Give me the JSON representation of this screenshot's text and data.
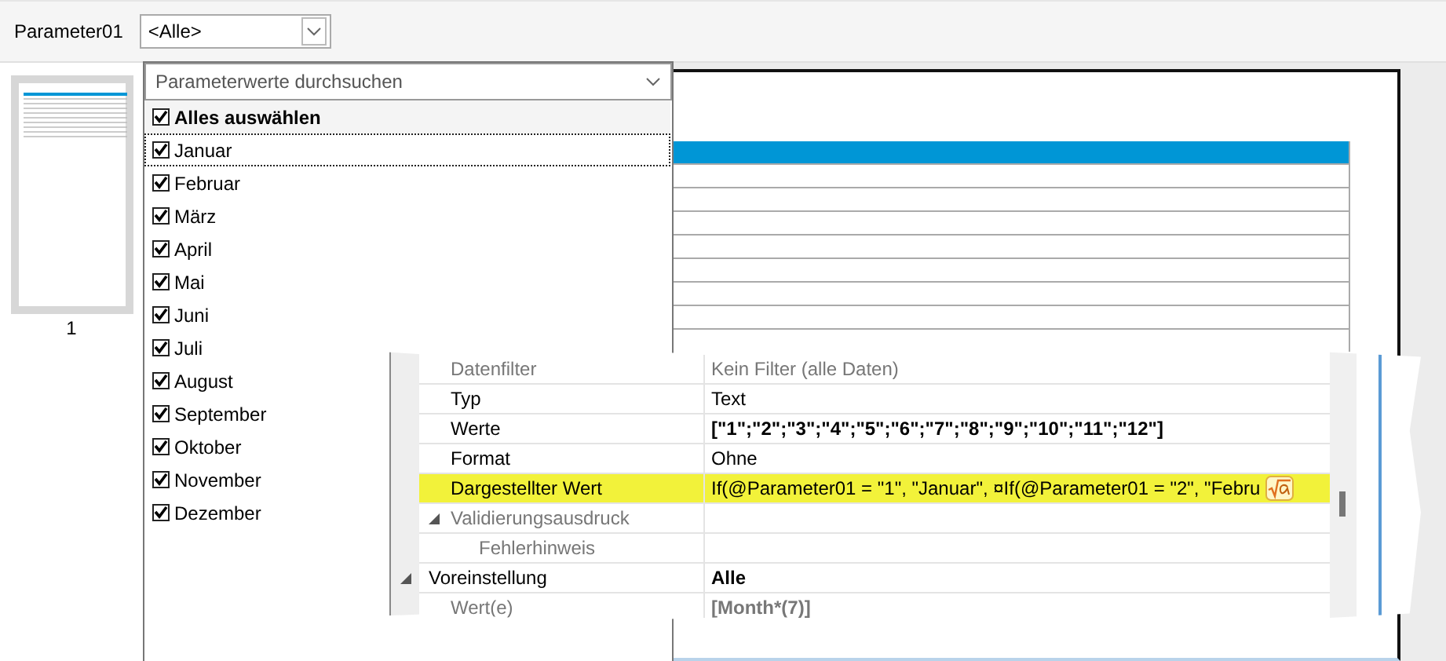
{
  "parameter": {
    "label": "Parameter01",
    "value": "<Alle>"
  },
  "thumbnails": [
    {
      "page": "1",
      "selected": true
    }
  ],
  "dropdown": {
    "placeholder": "Parameterwerte durchsuchen",
    "select_all": {
      "label": "Alles auswählen",
      "checked": true
    },
    "items": [
      {
        "label": "Januar",
        "checked": true,
        "focused": true
      },
      {
        "label": "Februar",
        "checked": true,
        "focused": false
      },
      {
        "label": "März",
        "checked": true,
        "focused": false
      },
      {
        "label": "April",
        "checked": true,
        "focused": false
      },
      {
        "label": "Mai",
        "checked": true,
        "focused": false
      },
      {
        "label": "Juni",
        "checked": true,
        "focused": false
      },
      {
        "label": "Juli",
        "checked": true,
        "focused": false
      },
      {
        "label": "August",
        "checked": true,
        "focused": false
      },
      {
        "label": "September",
        "checked": true,
        "focused": false
      },
      {
        "label": "Oktober",
        "checked": true,
        "focused": false
      },
      {
        "label": "November",
        "checked": true,
        "focused": false
      },
      {
        "label": "Dezember",
        "checked": true,
        "focused": false
      }
    ]
  },
  "properties": [
    {
      "kind": "property",
      "name": "Datenfilter",
      "value": "Kein Filter (alle Daten)",
      "disabled": true,
      "highlighted": false,
      "bold_value": false
    },
    {
      "kind": "property",
      "name": "Typ",
      "value": "Text",
      "disabled": false,
      "highlighted": false,
      "bold_value": false
    },
    {
      "kind": "property",
      "name": "Werte",
      "value": "[\"1\";\"2\";\"3\";\"4\";\"5\";\"6\";\"7\";\"8\";\"9\";\"10\";\"11\";\"12\"]",
      "disabled": false,
      "highlighted": false,
      "bold_value": true
    },
    {
      "kind": "property",
      "name": "Format",
      "value": "Ohne",
      "disabled": false,
      "highlighted": false,
      "bold_value": false
    },
    {
      "kind": "expression",
      "name": "Dargestellter Wert",
      "value": "If(@Parameter01 = \"1\", \"Januar\", ¤If(@Parameter01 = \"2\", \"Febru",
      "disabled": false,
      "highlighted": true,
      "bold_value": false
    },
    {
      "kind": "group",
      "name": "Validierungsausdruck",
      "disabled": true,
      "expanded": true,
      "children": [
        {
          "name": "Fehlerhinweis",
          "disabled": true
        }
      ]
    },
    {
      "kind": "category",
      "name": "Voreinstellung",
      "value": "Alle",
      "disabled": false,
      "expanded": true,
      "bold_value": true
    },
    {
      "kind": "property",
      "name": "Wert(e)",
      "value": "[Month*(7)]",
      "disabled": true,
      "highlighted": false,
      "bold_value": true
    }
  ]
}
